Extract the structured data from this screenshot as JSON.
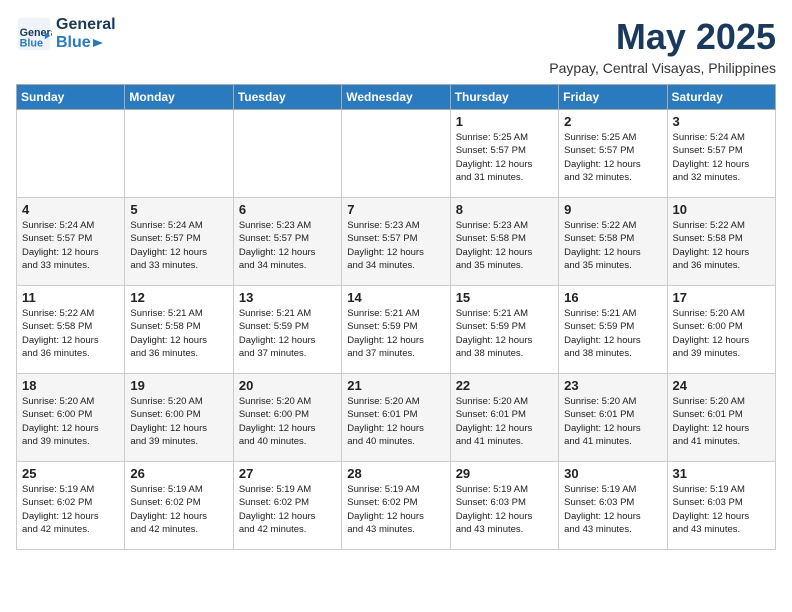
{
  "header": {
    "logo_general": "General",
    "logo_blue": "Blue",
    "month_year": "May 2025",
    "location": "Paypay, Central Visayas, Philippines"
  },
  "weekdays": [
    "Sunday",
    "Monday",
    "Tuesday",
    "Wednesday",
    "Thursday",
    "Friday",
    "Saturday"
  ],
  "weeks": [
    [
      {
        "day": "",
        "content": ""
      },
      {
        "day": "",
        "content": ""
      },
      {
        "day": "",
        "content": ""
      },
      {
        "day": "",
        "content": ""
      },
      {
        "day": "1",
        "content": "Sunrise: 5:25 AM\nSunset: 5:57 PM\nDaylight: 12 hours\nand 31 minutes."
      },
      {
        "day": "2",
        "content": "Sunrise: 5:25 AM\nSunset: 5:57 PM\nDaylight: 12 hours\nand 32 minutes."
      },
      {
        "day": "3",
        "content": "Sunrise: 5:24 AM\nSunset: 5:57 PM\nDaylight: 12 hours\nand 32 minutes."
      }
    ],
    [
      {
        "day": "4",
        "content": "Sunrise: 5:24 AM\nSunset: 5:57 PM\nDaylight: 12 hours\nand 33 minutes."
      },
      {
        "day": "5",
        "content": "Sunrise: 5:24 AM\nSunset: 5:57 PM\nDaylight: 12 hours\nand 33 minutes."
      },
      {
        "day": "6",
        "content": "Sunrise: 5:23 AM\nSunset: 5:57 PM\nDaylight: 12 hours\nand 34 minutes."
      },
      {
        "day": "7",
        "content": "Sunrise: 5:23 AM\nSunset: 5:57 PM\nDaylight: 12 hours\nand 34 minutes."
      },
      {
        "day": "8",
        "content": "Sunrise: 5:23 AM\nSunset: 5:58 PM\nDaylight: 12 hours\nand 35 minutes."
      },
      {
        "day": "9",
        "content": "Sunrise: 5:22 AM\nSunset: 5:58 PM\nDaylight: 12 hours\nand 35 minutes."
      },
      {
        "day": "10",
        "content": "Sunrise: 5:22 AM\nSunset: 5:58 PM\nDaylight: 12 hours\nand 36 minutes."
      }
    ],
    [
      {
        "day": "11",
        "content": "Sunrise: 5:22 AM\nSunset: 5:58 PM\nDaylight: 12 hours\nand 36 minutes."
      },
      {
        "day": "12",
        "content": "Sunrise: 5:21 AM\nSunset: 5:58 PM\nDaylight: 12 hours\nand 36 minutes."
      },
      {
        "day": "13",
        "content": "Sunrise: 5:21 AM\nSunset: 5:59 PM\nDaylight: 12 hours\nand 37 minutes."
      },
      {
        "day": "14",
        "content": "Sunrise: 5:21 AM\nSunset: 5:59 PM\nDaylight: 12 hours\nand 37 minutes."
      },
      {
        "day": "15",
        "content": "Sunrise: 5:21 AM\nSunset: 5:59 PM\nDaylight: 12 hours\nand 38 minutes."
      },
      {
        "day": "16",
        "content": "Sunrise: 5:21 AM\nSunset: 5:59 PM\nDaylight: 12 hours\nand 38 minutes."
      },
      {
        "day": "17",
        "content": "Sunrise: 5:20 AM\nSunset: 6:00 PM\nDaylight: 12 hours\nand 39 minutes."
      }
    ],
    [
      {
        "day": "18",
        "content": "Sunrise: 5:20 AM\nSunset: 6:00 PM\nDaylight: 12 hours\nand 39 minutes."
      },
      {
        "day": "19",
        "content": "Sunrise: 5:20 AM\nSunset: 6:00 PM\nDaylight: 12 hours\nand 39 minutes."
      },
      {
        "day": "20",
        "content": "Sunrise: 5:20 AM\nSunset: 6:00 PM\nDaylight: 12 hours\nand 40 minutes."
      },
      {
        "day": "21",
        "content": "Sunrise: 5:20 AM\nSunset: 6:01 PM\nDaylight: 12 hours\nand 40 minutes."
      },
      {
        "day": "22",
        "content": "Sunrise: 5:20 AM\nSunset: 6:01 PM\nDaylight: 12 hours\nand 41 minutes."
      },
      {
        "day": "23",
        "content": "Sunrise: 5:20 AM\nSunset: 6:01 PM\nDaylight: 12 hours\nand 41 minutes."
      },
      {
        "day": "24",
        "content": "Sunrise: 5:20 AM\nSunset: 6:01 PM\nDaylight: 12 hours\nand 41 minutes."
      }
    ],
    [
      {
        "day": "25",
        "content": "Sunrise: 5:19 AM\nSunset: 6:02 PM\nDaylight: 12 hours\nand 42 minutes."
      },
      {
        "day": "26",
        "content": "Sunrise: 5:19 AM\nSunset: 6:02 PM\nDaylight: 12 hours\nand 42 minutes."
      },
      {
        "day": "27",
        "content": "Sunrise: 5:19 AM\nSunset: 6:02 PM\nDaylight: 12 hours\nand 42 minutes."
      },
      {
        "day": "28",
        "content": "Sunrise: 5:19 AM\nSunset: 6:02 PM\nDaylight: 12 hours\nand 43 minutes."
      },
      {
        "day": "29",
        "content": "Sunrise: 5:19 AM\nSunset: 6:03 PM\nDaylight: 12 hours\nand 43 minutes."
      },
      {
        "day": "30",
        "content": "Sunrise: 5:19 AM\nSunset: 6:03 PM\nDaylight: 12 hours\nand 43 minutes."
      },
      {
        "day": "31",
        "content": "Sunrise: 5:19 AM\nSunset: 6:03 PM\nDaylight: 12 hours\nand 43 minutes."
      }
    ]
  ]
}
